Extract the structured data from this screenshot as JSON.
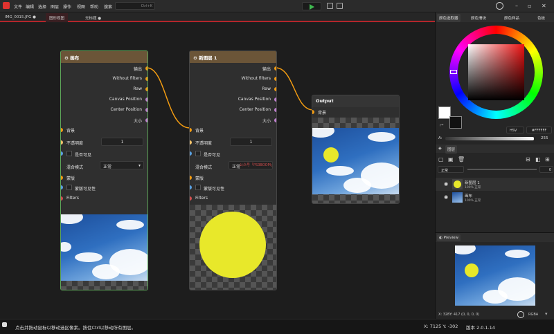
{
  "menubar": {
    "items": [
      "文件",
      "编辑",
      "选择",
      "图层",
      "操作",
      "视图",
      "帮助"
    ],
    "search_label": "搜索",
    "search_shortcut": "Ctrl+K"
  },
  "tabs": [
    {
      "label": "IMG_0015.JPG ●"
    },
    {
      "label": "图形视图"
    },
    {
      "label": "无标题 ●"
    }
  ],
  "nodes": {
    "canvas": {
      "title": "画布",
      "outputs": [
        "输出",
        "Without filters",
        "Raw",
        "Canvas Position",
        "Center Position",
        "大小"
      ],
      "inputs": {
        "background": "背景",
        "opacity": "不透明度",
        "opacity_value": "1",
        "visible": "是否可见",
        "blend_mode": "混合模式",
        "blend_value": "正常",
        "mask": "蒙版",
        "mask_visible": "蒙版可见性",
        "filters": "Filters"
      }
    },
    "layer": {
      "title": "新图层 1",
      "outputs": [
        "输出",
        "Without filters",
        "Raw",
        "Canvas Position",
        "Center Position",
        "大小"
      ],
      "inputs": {
        "background": "背景",
        "opacity": "不透明度",
        "opacity_value": "1",
        "visible": "是否可见",
        "blend_mode": "混合模式",
        "blend_value": "正常",
        "mask": "蒙版",
        "mask_visible": "蒙版可见性",
        "filters": "Filters"
      },
      "watermark": "公众号「PS3BOOM」"
    },
    "output": {
      "title": "Output",
      "input": "背景"
    }
  },
  "right_panel": {
    "tabs": [
      "颜色选取器",
      "颜色滑块",
      "颜色样品",
      "色板"
    ],
    "color_mode": "HSV",
    "hex_value": "#FFFFFF",
    "alpha_label": "A:",
    "alpha_value": "255",
    "layers_title": "图层",
    "blend_mode": "正常",
    "layer_opacity": "0",
    "layers": [
      {
        "name": "新图层 1",
        "detail": "100% 正常"
      },
      {
        "name": "画布",
        "detail": "100% 正常"
      }
    ],
    "preview_title": "Preview",
    "coords": "X: 328Y: 417  (0, 0, 0, 0)",
    "color_format": "RGBA"
  },
  "status": {
    "hint": "点击并拖动鼠标以移动选区像素。按住Ctrl以移动所有图层。",
    "position": "X: 7125 Y: -302",
    "version": "版本 2.0.1.14"
  },
  "colors": {
    "accent": "#b3262b",
    "node_header": "#6b5538",
    "wire": "#f39c12",
    "canvas_border": "#5fa85a",
    "layer_dot": "#c6e82a"
  }
}
